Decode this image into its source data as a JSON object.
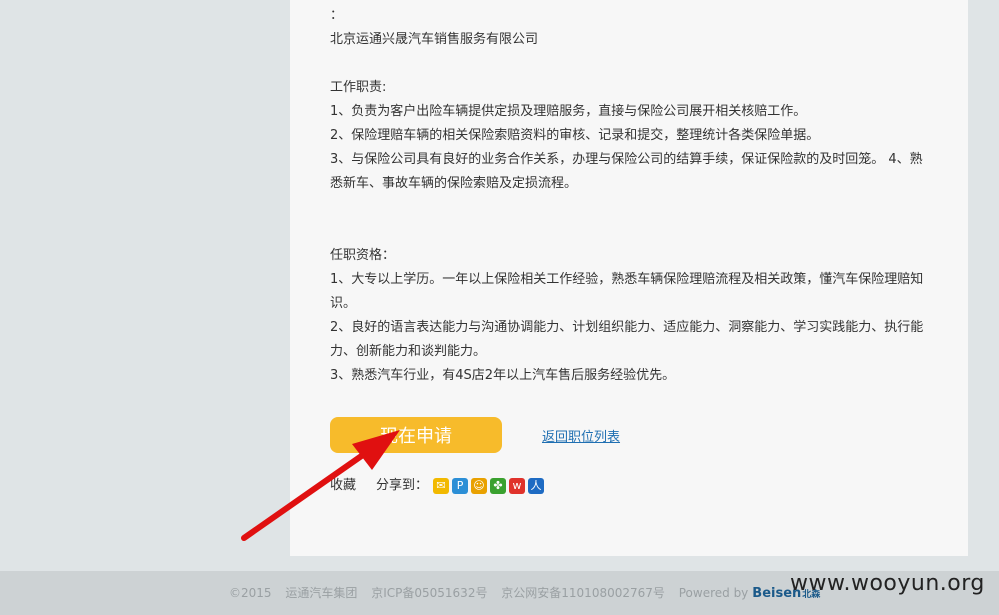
{
  "job": {
    "colon": "：",
    "company": "北京运通兴晟汽车销售服务有限公司",
    "duties_title": "工作职责:",
    "duties": [
      "1、负责为客户出险车辆提供定损及理赔服务，直接与保险公司展开相关核赔工作。",
      "2、保险理赔车辆的相关保险索赔资料的审核、记录和提交，整理统计各类保险单据。",
      "3、与保险公司具有良好的业务合作关系，办理与保险公司的结算手续，保证保险款的及时回笼。 4、熟悉新车、事故车辆的保险索赔及定损流程。"
    ],
    "qual_title": "任职资格：",
    "quals": [
      "1、大专以上学历。一年以上保险相关工作经验，熟悉车辆保险理赔流程及相关政策，懂汽车保险理赔知识。",
      "2、良好的语言表达能力与沟通协调能力、计划组织能力、适应能力、洞察能力、学习实践能力、执行能力、创新能力和谈判能力。",
      "3、熟悉汽车行业，有4S店2年以上汽车售后服务经验优先。"
    ]
  },
  "actions": {
    "apply_label": "现在申请",
    "back_label": "返回职位列表",
    "favorite_label": "收藏",
    "share_label": "分享到："
  },
  "share_icons": [
    {
      "name": "mail-icon",
      "glyph": "✉",
      "color": "#f2b900"
    },
    {
      "name": "qzone-icon",
      "glyph": "P",
      "color": "#2c8fd6"
    },
    {
      "name": "qq-icon",
      "glyph": "☺",
      "color": "#e9a100"
    },
    {
      "name": "clover-icon",
      "glyph": "✤",
      "color": "#3aa12f"
    },
    {
      "name": "weibo-icon",
      "glyph": "w",
      "color": "#e0322b"
    },
    {
      "name": "renren-icon",
      "glyph": "人",
      "color": "#1e6bc3"
    }
  ],
  "footer": {
    "copyright": "©2015",
    "group": "运通汽车集团",
    "icp": "京ICP备05051632号",
    "security": "京公网安备110108002767号",
    "powered": "Powered by",
    "brand": "Beisen",
    "brand_cn": "北森"
  },
  "watermark": "www.wooyun.org",
  "colors": {
    "accent_button": "#f7bb2b",
    "link": "#1f6fb2",
    "arrow": "#e01010"
  }
}
